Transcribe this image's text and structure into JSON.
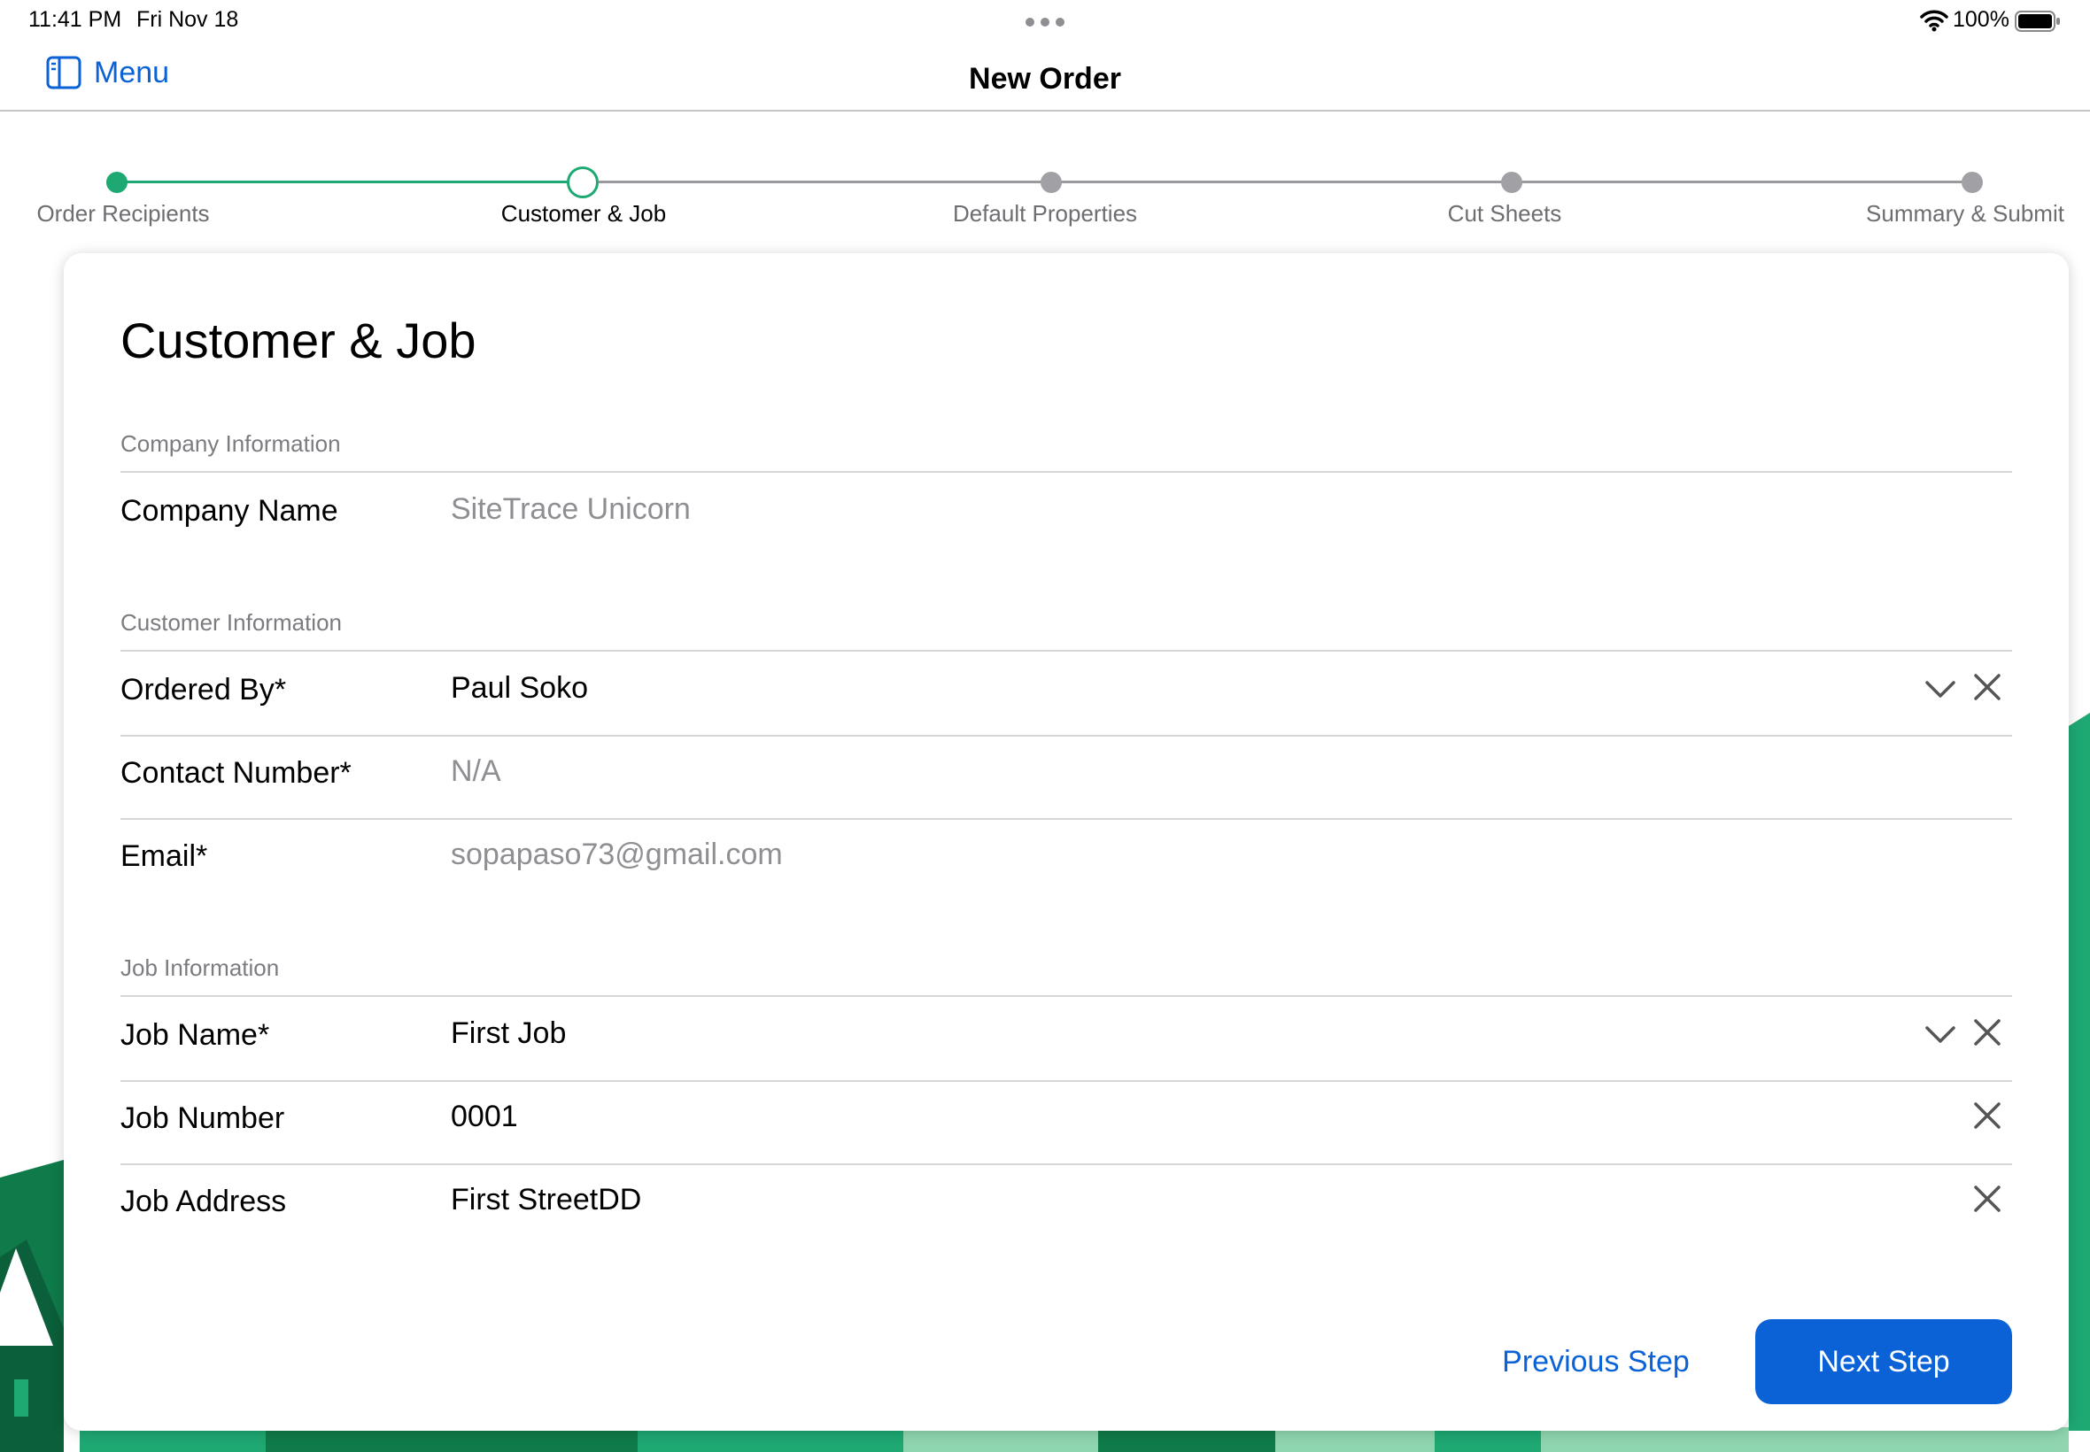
{
  "status_bar": {
    "time": "11:41 PM",
    "date": "Fri Nov 18",
    "battery_pct": "100%"
  },
  "nav": {
    "menu_label": "Menu",
    "title": "New Order"
  },
  "stepper": {
    "steps": [
      {
        "label": "Order Recipients",
        "state": "done"
      },
      {
        "label": "Customer & Job",
        "state": "current"
      },
      {
        "label": "Default Properties",
        "state": "todo"
      },
      {
        "label": "Cut Sheets",
        "state": "todo"
      },
      {
        "label": "Summary & Submit",
        "state": "todo"
      }
    ]
  },
  "card": {
    "title": "Customer & Job",
    "company_section": {
      "header": "Company Information",
      "company_name_label": "Company Name",
      "company_name_value": "SiteTrace Unicorn"
    },
    "customer_section": {
      "header": "Customer Information",
      "ordered_by_label": "Ordered By*",
      "ordered_by_value": "Paul Soko",
      "contact_label": "Contact Number*",
      "contact_value": "N/A",
      "email_label": "Email*",
      "email_value": "sopapaso73@gmail.com"
    },
    "job_section": {
      "header": "Job Information",
      "job_name_label": "Job Name*",
      "job_name_value": "First Job",
      "job_number_label": "Job Number",
      "job_number_value": "0001",
      "job_address_label": "Job Address",
      "job_address_value": "First StreetDD"
    },
    "actions": {
      "previous_label": "Previous Step",
      "next_label": "Next Step"
    }
  },
  "icons": {
    "menu": "sidebar-icon",
    "chevron": "chevron-down-icon",
    "clear": "close-icon",
    "wifi": "wifi-icon",
    "battery": "battery-icon"
  },
  "colors": {
    "accent_blue": "#0a62d6",
    "step_green": "#1ea872",
    "step_gray": "#a0a0a5",
    "background_greens": [
      "#0f7a4a",
      "#1ea872",
      "#8fd6b0"
    ]
  }
}
